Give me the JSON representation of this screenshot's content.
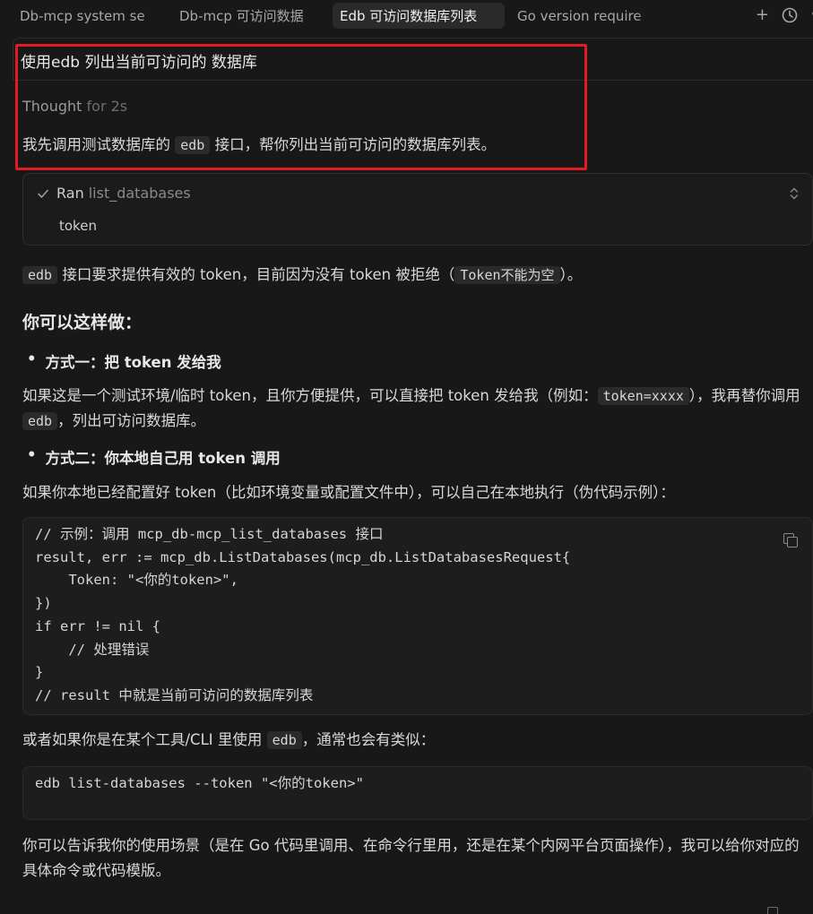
{
  "tabs": [
    {
      "label": "Db-mcp system se",
      "active": false
    },
    {
      "label": "Db-mcp 可访问数据",
      "active": false
    },
    {
      "label": "Edb 可访问数据库列表",
      "active": true
    },
    {
      "label": "Go version require",
      "active": false
    }
  ],
  "tab_actions": {
    "add_glyph": "+",
    "more_glyph": "·"
  },
  "user_message": "使用edb 列出当前可访问的 数据库",
  "thought": {
    "label": "Thought",
    "duration": "for 2s"
  },
  "intro": {
    "pre": "我先调用测试数据库的 ",
    "code": "edb",
    "post": " 接口，帮你列出当前可访问的数据库列表。"
  },
  "tool_call": {
    "status": "Ran",
    "name": "list_databases",
    "arg": "token"
  },
  "error_line": {
    "code1": "edb",
    "mid": " 接口要求提供有效的 token，目前因为没有 token 被拒绝（",
    "code2": "Token不能为空",
    "end": "）。"
  },
  "heading": "你可以这样做：",
  "option1": {
    "bullet": "•",
    "title": "方式一：把 token 发给我",
    "pre": "如果这是一个测试环境/临时 token，且你方便提供，可以直接把 token 发给我（例如：",
    "code": "token=xxxx",
    "mid": "），我再替你调用 ",
    "code2": "edb",
    "end": "，列出可访问数据库。"
  },
  "option2": {
    "bullet": "•",
    "title": "方式二：你本地自己用 token 调用",
    "desc": "如果你本地已经配置好 token（比如环境变量或配置文件中），可以自己在本地执行（伪代码示例）："
  },
  "code_block_1": "// 示例：调用 mcp_db-mcp_list_databases 接口\nresult, err := mcp_db.ListDatabases(mcp_db.ListDatabasesRequest{\n    Token: \"<你的token>\",\n})\nif err != nil {\n    // 处理错误\n}\n// result 中就是当前可访问的数据库列表",
  "cli_line": {
    "pre": "或者如果你是在某个工具/CLI 里使用 ",
    "code": "edb",
    "end": "，通常也会有类似："
  },
  "code_block_2": "edb list-databases --token \"<你的token>\"",
  "closing": "你可以告诉我你的使用场景（是在 Go 代码里调用、在命令行里用，还是在某个内网平台页面操作），我可以给你对应的具体命令或代码模版。"
}
